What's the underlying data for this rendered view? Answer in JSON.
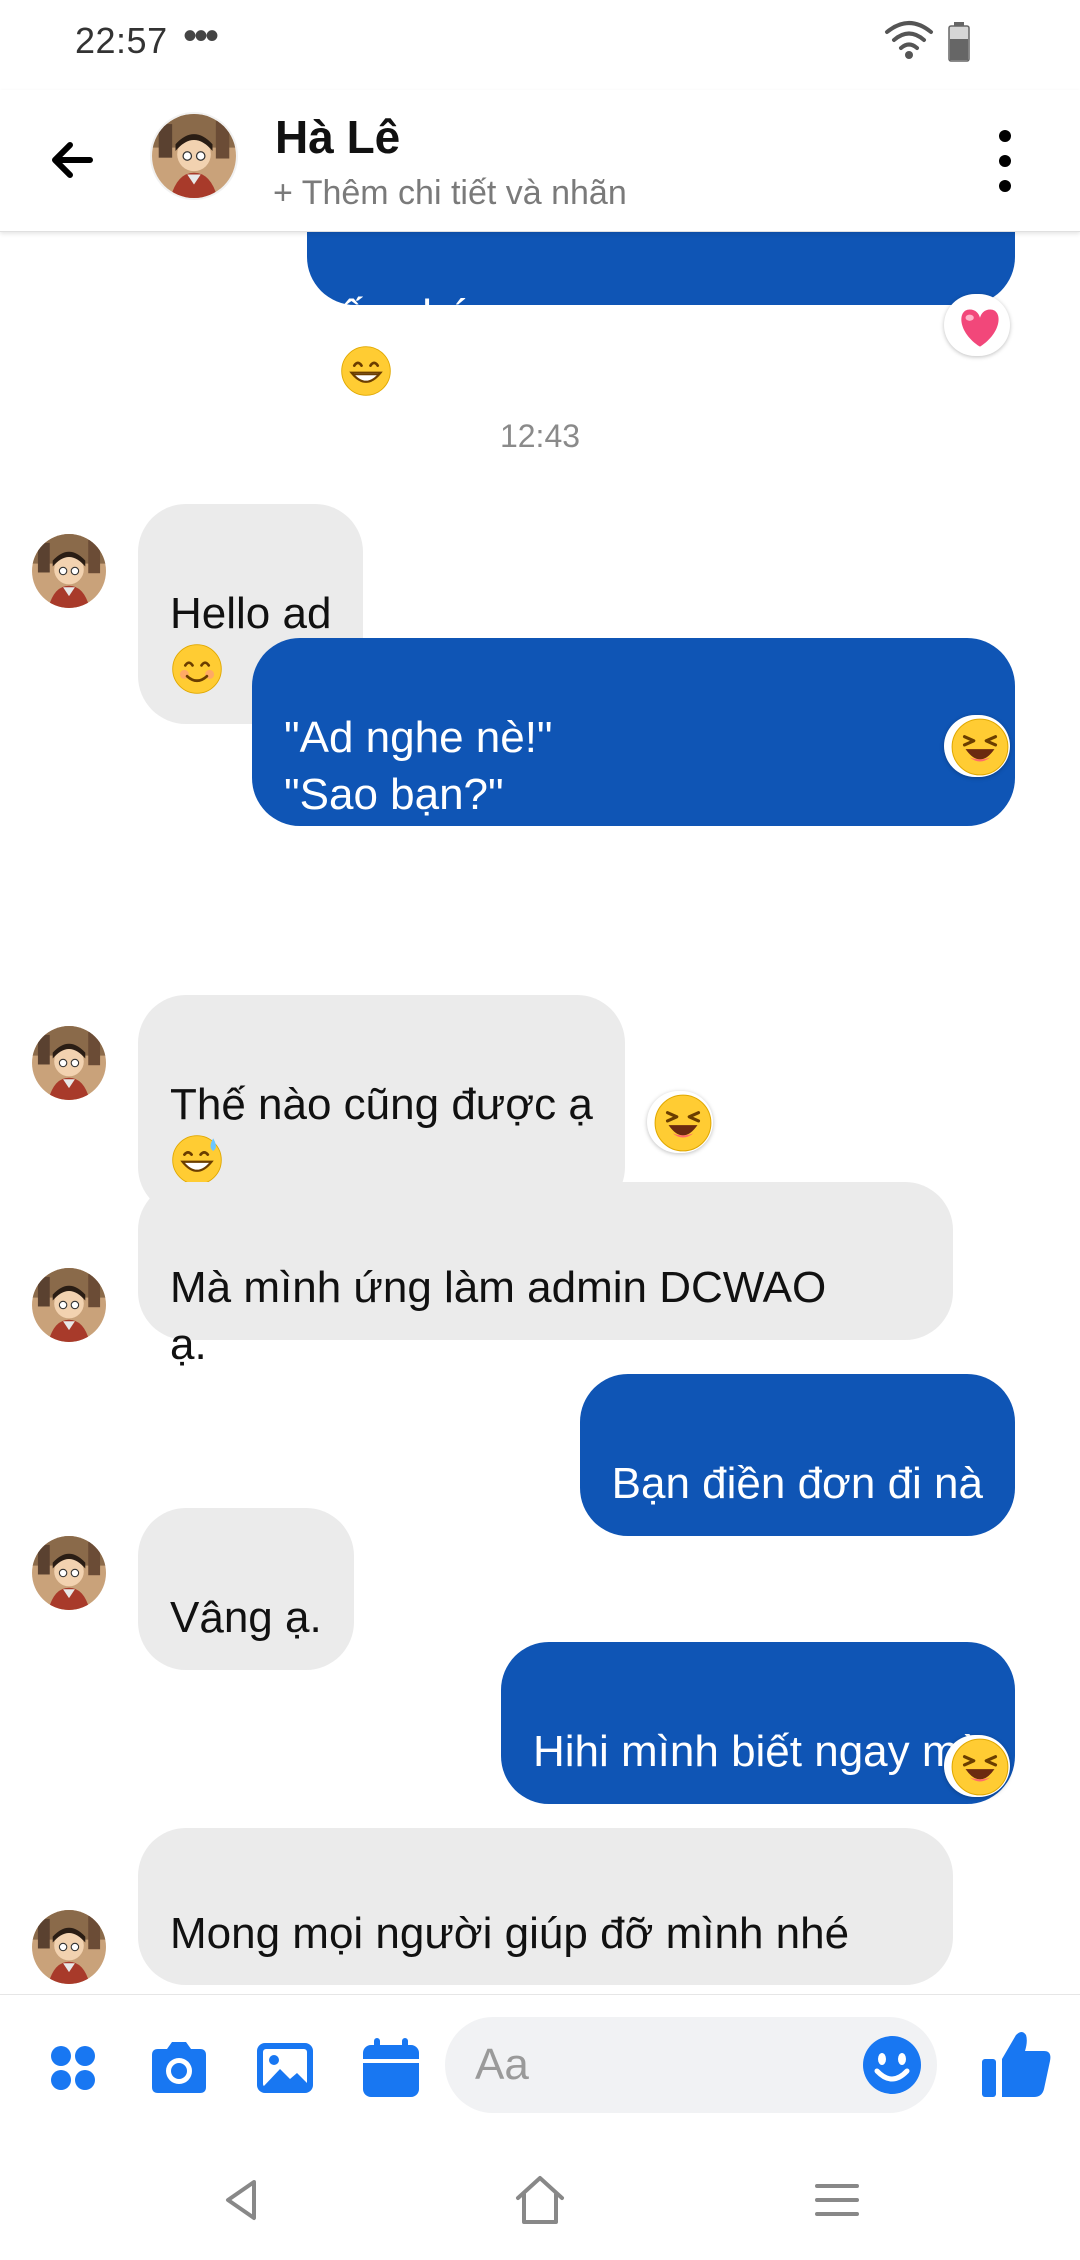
{
  "status_bar": {
    "time": "22:57",
    "dots": "•••"
  },
  "header": {
    "contact_name": "Hà Lê",
    "subtitle": "+ Thêm chi tiết và nhãn"
  },
  "messages": {
    "m0": "ấy nhé",
    "timestamp": "12:43",
    "m1": "Hello ad",
    "m2": "\"Ad nghe nè!\"\n\"Sao bạn?\"\nBạn thích ad rep kiểu dễ thương\nhay cục súc?",
    "m3": "Thế nào cũng được ạ",
    "m4": "Mà mình ứng làm admin DCWAO\nạ.",
    "m5": "Bạn điền đơn đi nà",
    "m6": "Vâng ạ.",
    "m7": "Hihi mình biết ngay mà",
    "m8": "Mong mọi người giúp đỡ mình nhé"
  },
  "reactions": {
    "m0": "heart",
    "m2": "laughing",
    "m3": "laughing",
    "m7": "laughing"
  },
  "composer": {
    "placeholder": "Aa"
  },
  "colors": {
    "outgoing": "#0f55b5",
    "incoming": "#ebebeb",
    "accent": "#1877f2"
  },
  "icons": [
    "back-arrow-icon",
    "more-icon",
    "apps-grid-icon",
    "camera-icon",
    "gallery-icon",
    "calendar-icon",
    "emoji-icon",
    "thumbs-up-icon",
    "nav-back-icon",
    "nav-home-icon",
    "nav-menu-icon"
  ]
}
